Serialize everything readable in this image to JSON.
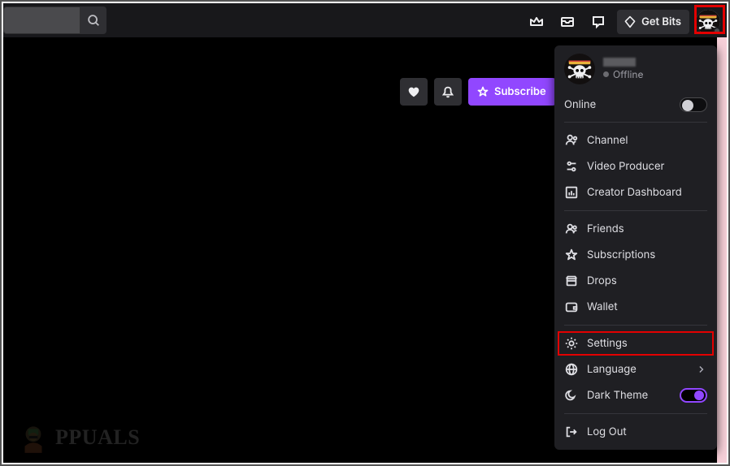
{
  "search": {
    "value": "",
    "placeholder": ""
  },
  "top": {
    "get_bits": "Get Bits"
  },
  "actions": {
    "subscribe": "Subscribe"
  },
  "dropdown": {
    "username": "",
    "status": "Offline",
    "online_label": "Online",
    "sections": {
      "channel": "Channel",
      "video_producer": "Video Producer",
      "creator_dashboard": "Creator Dashboard",
      "friends": "Friends",
      "subscriptions": "Subscriptions",
      "drops": "Drops",
      "wallet": "Wallet",
      "settings": "Settings",
      "language": "Language",
      "dark_theme": "Dark Theme",
      "log_out": "Log Out"
    }
  },
  "watermark": "PPUALS"
}
